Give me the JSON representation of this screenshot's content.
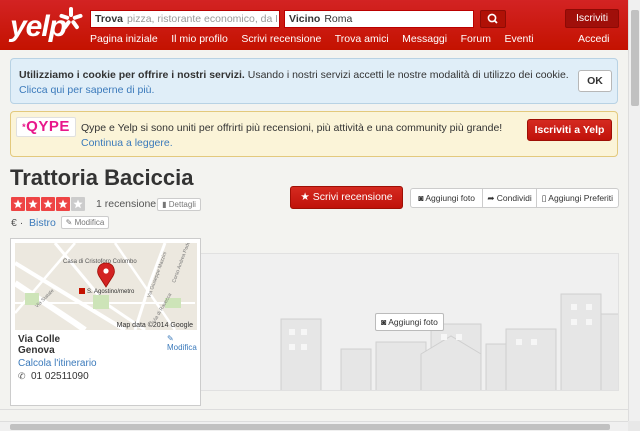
{
  "header": {
    "logo_text": "yelp",
    "search": {
      "find_label": "Trova",
      "find_placeholder": "pizza, ristorante economico, da Piero",
      "near_label": "Vicino",
      "near_value": "Roma"
    },
    "nav": [
      "Pagina iniziale",
      "Il mio profilo",
      "Scrivi recensione",
      "Trova amici",
      "Messaggi",
      "Forum",
      "Eventi"
    ],
    "signup": "Iscriviti",
    "login": "Accedi"
  },
  "cookie": {
    "bold": "Utilizziamo i cookie per offrire i nostri servizi.",
    "text": " Usando i nostri servizi accetti le nostre modalità di utilizzo dei cookie.",
    "link": "Clicca qui per saperne di più.",
    "ok": "OK"
  },
  "qype": {
    "logo": "QYPE",
    "text": "Qype e Yelp si sono uniti per offrirti più recensioni, più attività e una community più grande!",
    "link": "Continua a leggere.",
    "button": "Iscriviti a Yelp"
  },
  "business": {
    "name": "Trattoria Baciccia",
    "rating": 4,
    "rating_max": 5,
    "review_count": "1 recensione",
    "details": "Dettagli",
    "price": "€",
    "separator": "·",
    "category": "Bistro",
    "edit": "Modifica"
  },
  "actions": {
    "write_review": "Scrivi recensione",
    "add_photo": "Aggiungi foto",
    "share": "Condividi",
    "bookmark": "Aggiungi Preferiti"
  },
  "map": {
    "labels": [
      "Casa di Cristoforo Colombo",
      "S. Agostino/metro",
      "Via Giuseppe Mazzini",
      "Corso Andrea Podestà",
      "Via di Ravecca",
      "Via Statale"
    ],
    "attribution": "Map data ©2014 Google",
    "address_line1": "Via Colle",
    "address_line2": "Genova",
    "edit": "Modifica",
    "directions": "Calcola l'itinerario",
    "phone": "01 02511090"
  },
  "photo_area": {
    "add_photo": "Aggiungi foto"
  },
  "colors": {
    "brand_red": "#c41200",
    "link_blue": "#3b7abb",
    "star_red": "#e44",
    "qype_pink": "#e8188b"
  }
}
